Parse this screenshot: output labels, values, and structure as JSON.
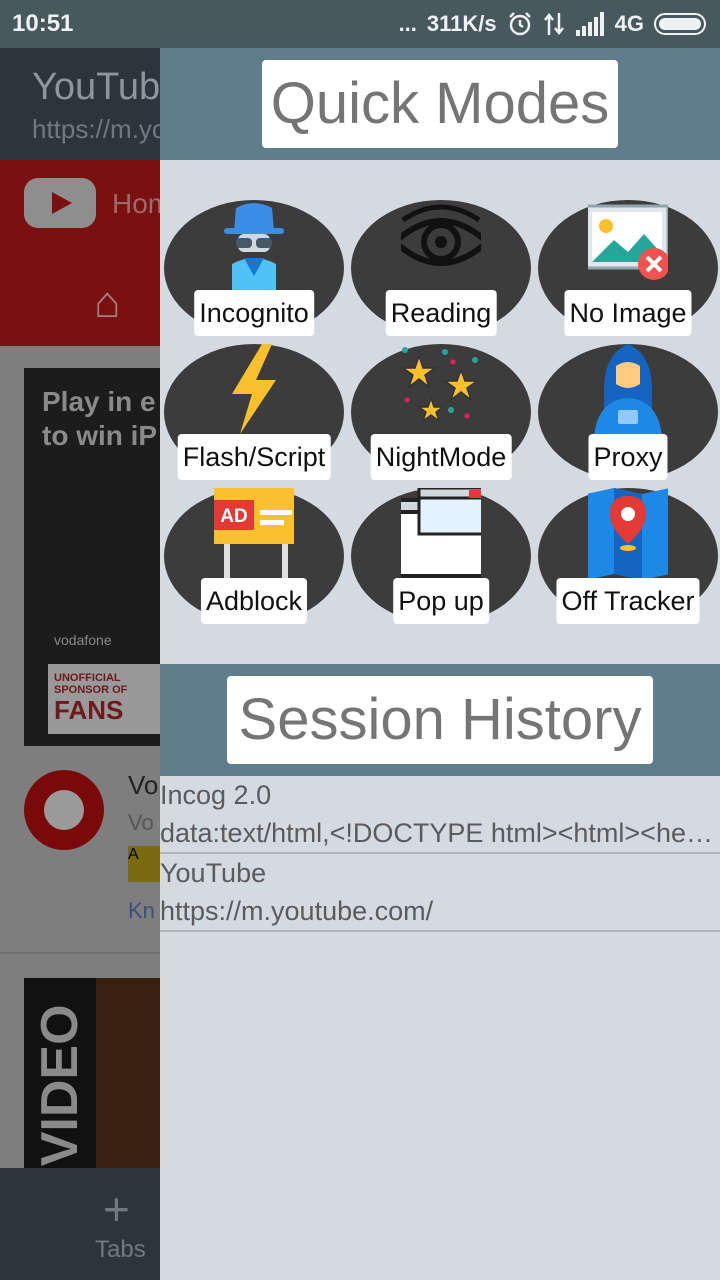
{
  "status_bar": {
    "time": "10:51",
    "dots": "...",
    "speed": "311K/s",
    "network": "4G"
  },
  "background_app": {
    "title": "YouTube",
    "url": "https://m.youtube.com/",
    "home_label": "Home",
    "ad_line1": "Play in e",
    "ad_line2": "to win iP",
    "ad_brand": "vodafone",
    "ad_sponsor": "UNOFFICIAL SPONSOR OF",
    "ad_fans": "FANS",
    "result_title": "Vo",
    "result_sub": "Vo",
    "result_badge": "A",
    "result_link": "Kn",
    "video_text": "L VIDEO",
    "tabs_plus": "+",
    "tabs_label": "Tabs"
  },
  "drawer": {
    "quick_modes_title": "Quick Modes",
    "modes": [
      {
        "label": "Incognito",
        "icon": "incognito-icon"
      },
      {
        "label": "Reading",
        "icon": "eye-icon"
      },
      {
        "label": "No Image",
        "icon": "no-image-icon"
      },
      {
        "label": "Flash/Script",
        "icon": "lightning-icon"
      },
      {
        "label": "NightMode",
        "icon": "stars-icon"
      },
      {
        "label": "Proxy",
        "icon": "hooded-user-icon"
      },
      {
        "label": "Adblock",
        "icon": "ad-sign-icon"
      },
      {
        "label": "Pop up",
        "icon": "popup-window-icon"
      },
      {
        "label": "Off Tracker",
        "icon": "map-pin-icon"
      }
    ],
    "session_history_title": "Session History",
    "history": [
      {
        "title": "Incog 2.0",
        "url": "data:text/html,<!DOCTYPE html><html><head><meta charset=\"utf-8\">"
      },
      {
        "title": "YouTube",
        "url": "https://m.youtube.com/"
      }
    ]
  },
  "colors": {
    "header_bg": "#607d8b",
    "drawer_bg": "#d3dbe1",
    "circle_bg": "#3c3c3c",
    "status_bar_bg": "#47585f"
  }
}
